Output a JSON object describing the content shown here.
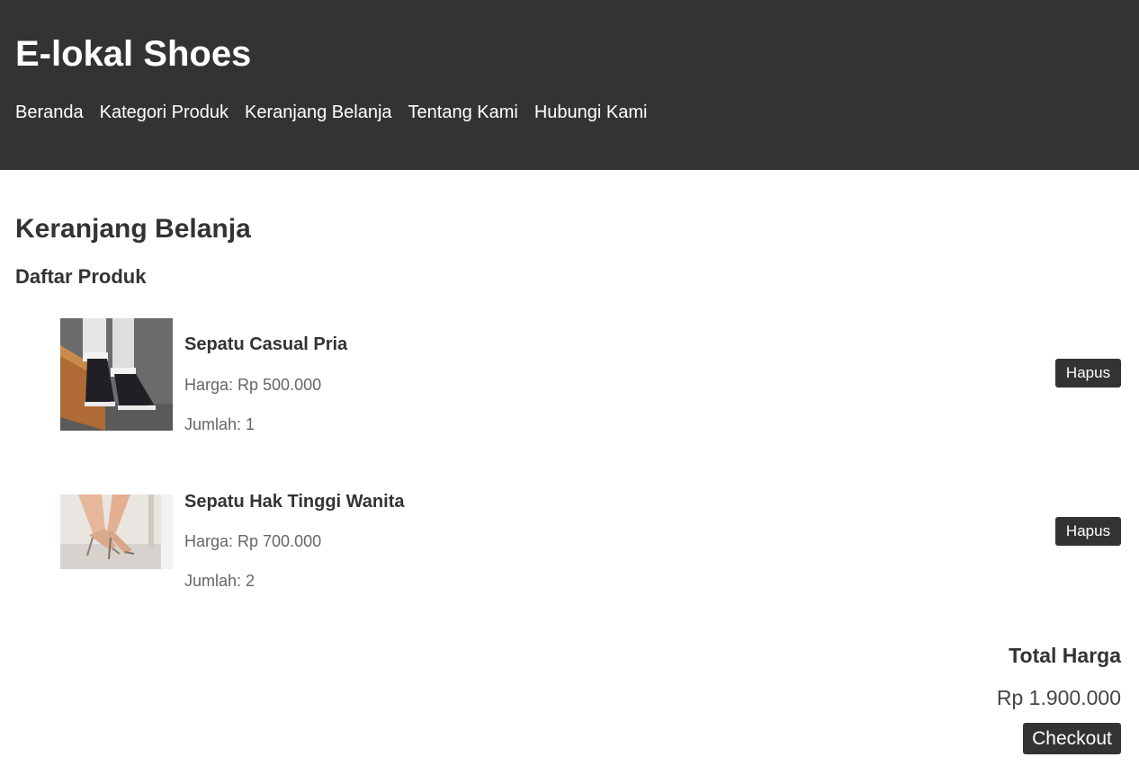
{
  "header": {
    "brand": "E-lokal Shoes",
    "nav": [
      "Beranda",
      "Kategori Produk",
      "Keranjang Belanja",
      "Tentang Kami",
      "Hubungi Kami"
    ]
  },
  "cart": {
    "title": "Keranjang Belanja",
    "list_title": "Daftar Produk",
    "items": [
      {
        "name": "Sepatu Casual Pria",
        "price": "Harga: Rp 500.000",
        "quantity": "Jumlah: 1",
        "remove_label": "Hapus"
      },
      {
        "name": "Sepatu Hak Tinggi Wanita",
        "price": "Harga: Rp 700.000",
        "quantity": "Jumlah: 2",
        "remove_label": "Hapus"
      }
    ],
    "total_label": "Total Harga",
    "total_value": "Rp 1.900.000",
    "checkout_label": "Checkout"
  },
  "colors": {
    "header_bg": "#333333",
    "button_bg": "#333333",
    "text": "#333333",
    "muted_text": "#666666"
  }
}
